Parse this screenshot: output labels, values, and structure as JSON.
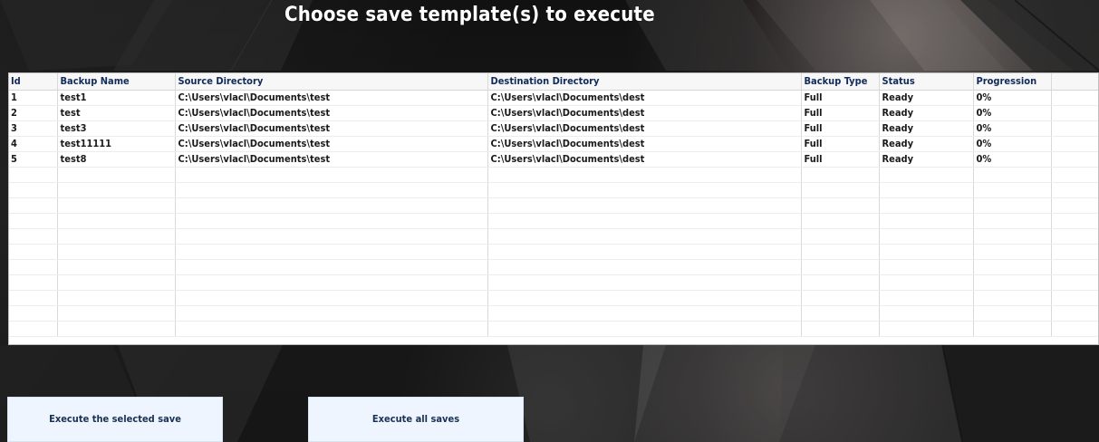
{
  "window": {
    "title": "Choose save template(s) to execute"
  },
  "table": {
    "columns": [
      {
        "key": "id",
        "label": "Id"
      },
      {
        "key": "backup_name",
        "label": "Backup Name"
      },
      {
        "key": "source_directory",
        "label": "Source Directory"
      },
      {
        "key": "destination_directory",
        "label": "Destination Directory"
      },
      {
        "key": "backup_type",
        "label": "Backup Type"
      },
      {
        "key": "status",
        "label": "Status"
      },
      {
        "key": "progression",
        "label": "Progression"
      },
      {
        "key": "spare",
        "label": ""
      }
    ],
    "rows": [
      {
        "id": "1",
        "backup_name": "test1",
        "source_directory": "C:\\Users\\vlacl\\Documents\\test",
        "destination_directory": "C:\\Users\\vlacl\\Documents\\dest",
        "backup_type": "Full",
        "status": "Ready",
        "progression": "0%",
        "spare": ""
      },
      {
        "id": "2",
        "backup_name": "test",
        "source_directory": "C:\\Users\\vlacl\\Documents\\test",
        "destination_directory": "C:\\Users\\vlacl\\Documents\\dest",
        "backup_type": "Full",
        "status": "Ready",
        "progression": "0%",
        "spare": ""
      },
      {
        "id": "3",
        "backup_name": "test3",
        "source_directory": "C:\\Users\\vlacl\\Documents\\test",
        "destination_directory": "C:\\Users\\vlacl\\Documents\\dest",
        "backup_type": "Full",
        "status": "Ready",
        "progression": "0%",
        "spare": ""
      },
      {
        "id": "4",
        "backup_name": "test11111",
        "source_directory": "C:\\Users\\vlacl\\Documents\\test",
        "destination_directory": "C:\\Users\\vlacl\\Documents\\dest",
        "backup_type": "Full",
        "status": "Ready",
        "progression": "0%",
        "spare": ""
      },
      {
        "id": "5",
        "backup_name": "test8",
        "source_directory": "C:\\Users\\vlacl\\Documents\\test",
        "destination_directory": "C:\\Users\\vlacl\\Documents\\dest",
        "backup_type": "Full",
        "status": "Ready",
        "progression": "0%",
        "spare": ""
      }
    ]
  },
  "buttons": {
    "execute_selected": "Execute the selected save",
    "execute_all": "Execute all saves"
  }
}
